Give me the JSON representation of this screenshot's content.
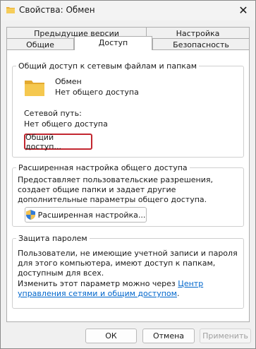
{
  "window": {
    "title": "Свойства: Обмен",
    "icon": "folder-icon",
    "close_glyph": "✕"
  },
  "tabs_row1": [
    {
      "label": "Предыдущие версии"
    },
    {
      "label": "Настройка"
    }
  ],
  "tabs_row2": [
    {
      "label": "Общие"
    },
    {
      "label": "Доступ",
      "active": true
    },
    {
      "label": "Безопасность"
    }
  ],
  "sharing": {
    "group_title": "Общий доступ к сетевым файлам и папкам",
    "folder_name": "Обмен",
    "folder_status": "Нет общего доступа",
    "network_path_label": "Сетевой путь:",
    "network_path_value": "Нет общего доступа",
    "share_button": "Общий доступ..."
  },
  "advanced": {
    "group_title": "Расширенная настройка общего доступа",
    "description": "Предоставляет пользовательские разрешения, создает общие папки и задает другие дополнительные параметры общего доступа.",
    "button": "Расширенная настройка..."
  },
  "password": {
    "group_title": "Защита паролем",
    "description": "Пользователи, не имеющие учетной записи и пароля для этого компьютера, имеют доступ к папкам, доступным для всех.",
    "change_text": "Изменить этот параметр можно через ",
    "link_text": "Центр управления сетями и общим доступом",
    "period": "."
  },
  "footer": {
    "ok": "ОК",
    "cancel": "Отмена",
    "apply": "Применить"
  },
  "colors": {
    "accent_focus": "#c2262f",
    "link": "#0066cc",
    "folder": "#f2c14e"
  }
}
